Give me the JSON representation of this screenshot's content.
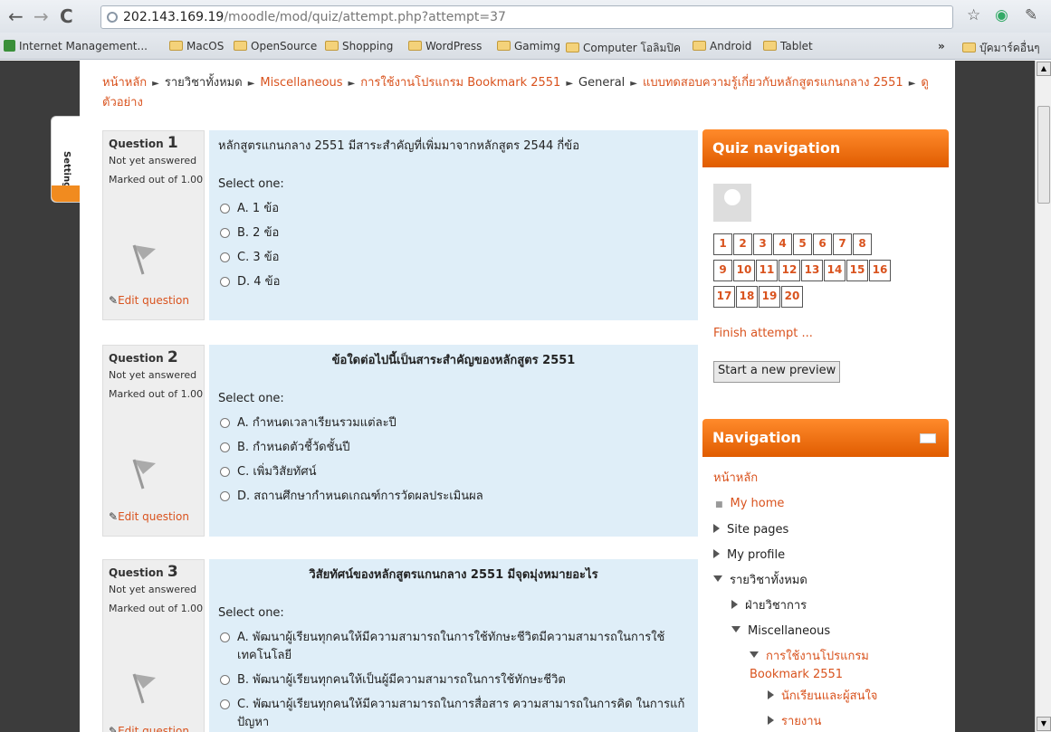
{
  "browser": {
    "url_host": "202.143.169.19",
    "url_path": "/moodle/mod/quiz/attempt.php?attempt=37",
    "bookmarks": [
      "Internet Management...",
      "MacOS",
      "OpenSource",
      "Shopping",
      "WordPress",
      "Gamimg",
      "Computer โอลิมปิค",
      "Android",
      "Tablet"
    ],
    "other_bookmarks": "บุ๊คมาร์คอื่นๆ",
    "overflow": "»"
  },
  "breadcrumb": {
    "items": [
      "หน้าหลัก",
      "รายวิชาทั้งหมด",
      "Miscellaneous",
      "การใช้งานโปรแกรม Bookmark 2551",
      "General",
      "แบบทดสอบความรู้เกี่ยวกับหลักสูตรแกนกลาง 2551",
      "ดูตัวอย่าง"
    ],
    "separator": "►"
  },
  "settings_tab": {
    "label": "Settings"
  },
  "questions": [
    {
      "label": "Question",
      "number": "1",
      "status": "Not yet answered",
      "marked": "Marked out of 1.00",
      "edit": "Edit question",
      "text": "หลักสูตรแกนกลาง 2551 มีสาระสำคัญที่เพิ่มมาจากหลักสูตร 2544 กี่ข้อ",
      "select_one": "Select one:",
      "options": [
        "A. 1 ข้อ",
        "B. 2 ข้อ",
        "C. 3 ข้อ",
        "D. 4 ข้อ"
      ]
    },
    {
      "label": "Question",
      "number": "2",
      "status": "Not yet answered",
      "marked": "Marked out of 1.00",
      "edit": "Edit question",
      "text": "ข้อใดต่อไปนี้เป็นสาระสำคัญของหลักสูตร 2551",
      "select_one": "Select one:",
      "options": [
        "A. กำหนดเวลาเรียนรวมแต่ละปี",
        "B. กำหนดตัวชี้วัดชั้นปี",
        "C. เพิ่มวิสัยทัศน์",
        "D. สถานศึกษากำหนดเกณฑ์การวัดผลประเมินผล"
      ]
    },
    {
      "label": "Question",
      "number": "3",
      "status": "Not yet answered",
      "marked": "Marked out of 1.00",
      "edit": "Edit question",
      "text": "วิสัยทัศน์ของหลักสูตรแกนกลาง 2551 มีจุดมุ่งหมายอะไร",
      "select_one": "Select one:",
      "options": [
        "A. พัฒนาผู้เรียนทุกคนให้มีความสามารถในการใช้ทักษะชีวิตมีความสามารถในการใช้เทคโนโลยี",
        "B. พัฒนาผู้เรียนทุกคนให้เป็นผู้มีความสามารถในการใช้ทักษะชีวิต",
        "C. พัฒนาผู้เรียนทุกคนให้มีความสามารถในการสื่อสาร ความสามารถในการคิด ในการแก้ปัญหา"
      ]
    }
  ],
  "quiz_nav": {
    "title": "Quiz navigation",
    "numbers": [
      "1",
      "2",
      "3",
      "4",
      "5",
      "6",
      "7",
      "8",
      "9",
      "10",
      "11",
      "12",
      "13",
      "14",
      "15",
      "16",
      "17",
      "18",
      "19",
      "20"
    ],
    "finish": "Finish attempt ...",
    "preview_button": "Start a new preview"
  },
  "navigation": {
    "title": "Navigation",
    "home": "หน้าหลัก",
    "my_home": "My home",
    "site_pages": "Site pages",
    "my_profile": "My profile",
    "all_courses": "รายวิชาทั้งหมด",
    "academic": "ฝ่ายวิชาการ",
    "misc": "Miscellaneous",
    "course": "การใช้งานโปรแกรม Bookmark 2551",
    "students": "นักเรียนและผู้สนใจ",
    "reports": "รายงาน"
  },
  "colors": {
    "accent": "#d9531e",
    "block_header": "#f07a1a",
    "question_bg": "#dfeef8"
  }
}
